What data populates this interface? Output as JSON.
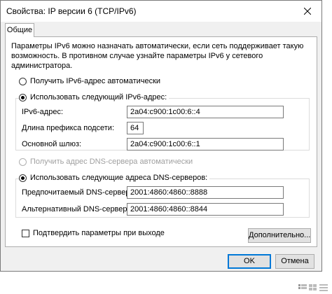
{
  "window": {
    "title": "Свойства: IP версии 6 (TCP/IPv6)"
  },
  "tabs": [
    {
      "label": "Общие"
    }
  ],
  "description": "Параметры IPv6 можно назначать автоматически, если сеть поддерживает такую возможность. В противном случае узнайте параметры IPv6 у сетевого администратора.",
  "ip": {
    "auto_label": "Получить IPv6-адрес автоматически",
    "manual_label": "Использовать следующий IPv6-адрес:",
    "selected": "manual",
    "address_label": "IPv6-адрес:",
    "address_value": "2a04:c900:1c00:6::4",
    "prefix_label": "Длина префикса подсети:",
    "prefix_value": "64",
    "gateway_label": "Основной шлюз:",
    "gateway_value": "2a04:c900:1c00:6::1"
  },
  "dns": {
    "auto_label": "Получить адрес DNS-сервера автоматически",
    "manual_label": "Использовать следующие адреса DNS-серверов:",
    "selected": "manual",
    "preferred_label": "Предпочитаемый DNS-сервер:",
    "preferred_value": "2001:4860:4860::8888",
    "alternate_label": "Альтернативный DNS-сервер:",
    "alternate_value": "2001:4860:4860::8844"
  },
  "validate_label": "Подтвердить параметры при выходе",
  "validate_checked": false,
  "buttons": {
    "advanced": "Дополнительно...",
    "ok": "OK",
    "cancel": "Отмена"
  },
  "icons": {
    "close": "close-icon",
    "watermark": "grid-icon"
  },
  "colors": {
    "accent": "#0078d7",
    "window_bg": "#f0f0f0"
  }
}
